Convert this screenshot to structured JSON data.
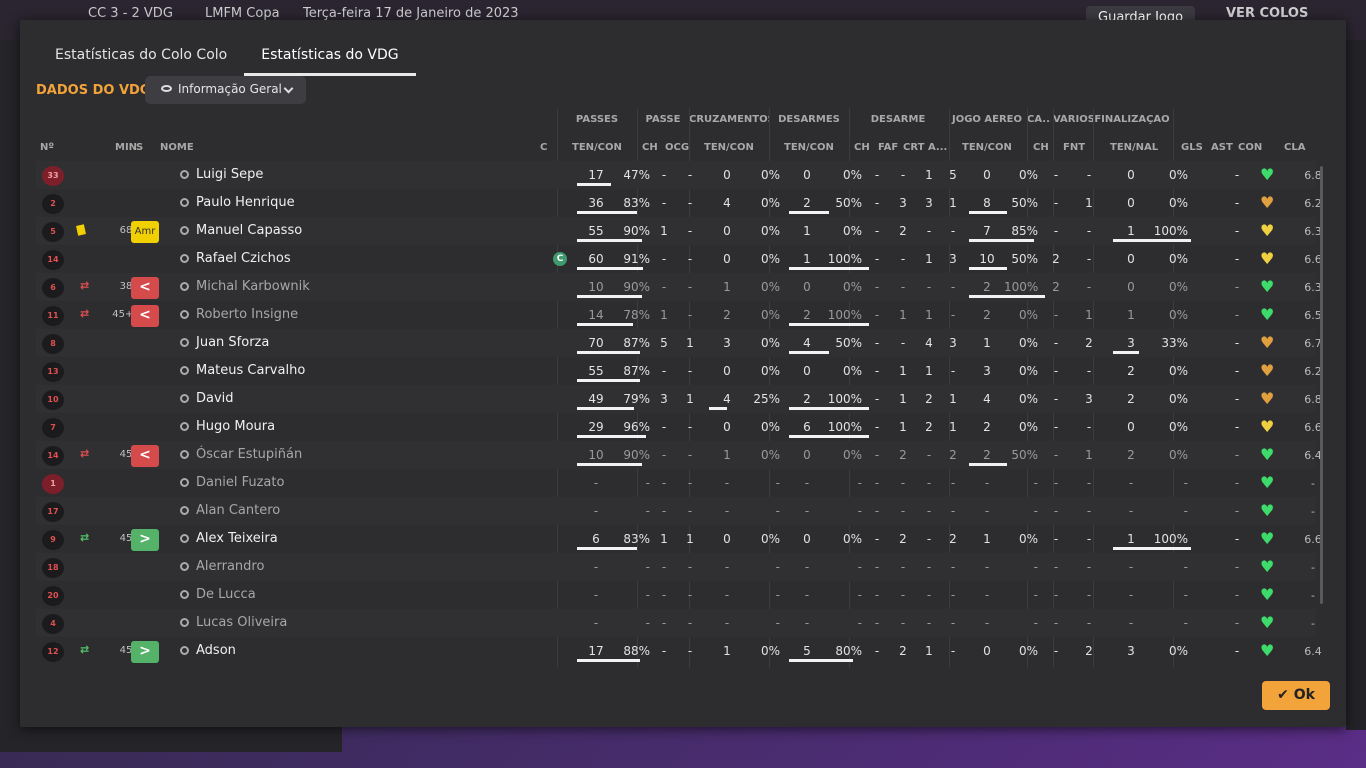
{
  "background": {
    "score": "CC 3 - 2 VDG",
    "league": "LMFM Copa",
    "date": "Terça-feira 17 de Janeiro de 2023",
    "save_label": "Guardar Jogo",
    "ver_label": "VER COLOS"
  },
  "tabs": [
    "Estatísticas do Colo Colo",
    "Estatísticas do VDG"
  ],
  "section_title": "DADOS DO VDG",
  "dropdown_label": "Informação Geral",
  "group_headers": [
    "PASSES",
    "PASSE",
    "CRUZAMENTOS",
    "DESARMES",
    "DESARME",
    "JOGO AÉREO",
    "CA...",
    "VÁRIOS",
    "FINALIZAÇÃO"
  ],
  "column_headers": {
    "no": "Nº",
    "min": "MIN",
    "s": "S",
    "nome": "NOME",
    "c": "C",
    "passes": "TEN/CON",
    "ch": "CH",
    "ocg": "OCG",
    "cruz": "TEN/CON",
    "des": "TEN/CON",
    "dch": "CH",
    "faf": "FAF",
    "crt": "CRT",
    "a": "A...",
    "aereo": "TEN/CON",
    "ca_ch": "CH",
    "fnt": "FNT",
    "fin": "TEN/NAL",
    "gls": "GLS",
    "ast": "AST",
    "con": "CON",
    "cla": "CLA"
  },
  "players": [
    {
      "no": "33",
      "gk": true,
      "name": "Luigi Sepe",
      "dim": false,
      "card": false,
      "sub": "",
      "min": "",
      "s": "",
      "cap": false,
      "p": [
        "17",
        "47%"
      ],
      "pc": [
        "-",
        "-"
      ],
      "cr": [
        "0",
        "0%"
      ],
      "de": [
        "0",
        "0%"
      ],
      "ds": [
        "-",
        "-",
        "1",
        "5"
      ],
      "ae": [
        "0",
        "0%"
      ],
      "ca": "-",
      "fnt": "-",
      "fi": [
        "0",
        "0%"
      ],
      "ast": "-",
      "heart": "#3ddc6a",
      "cla": "6.8"
    },
    {
      "no": "2",
      "gk": false,
      "name": "Paulo Henrique",
      "dim": false,
      "card": false,
      "sub": "",
      "min": "",
      "s": "",
      "cap": false,
      "p": [
        "36",
        "83%"
      ],
      "pc": [
        "-",
        "-"
      ],
      "cr": [
        "4",
        "0%"
      ],
      "de": [
        "2",
        "50%"
      ],
      "ds": [
        "-",
        "3",
        "3",
        "1"
      ],
      "ae": [
        "8",
        "50%"
      ],
      "ca": "-",
      "fnt": "1",
      "fi": [
        "0",
        "0%"
      ],
      "ast": "-",
      "heart": "#e0a040",
      "cla": "6.2"
    },
    {
      "no": "5",
      "gk": false,
      "name": "Manuel Capasso",
      "dim": false,
      "card": true,
      "sub": "amr",
      "min": "68",
      "s": "Amr",
      "cap": false,
      "p": [
        "55",
        "90%"
      ],
      "pc": [
        "1",
        "-"
      ],
      "cr": [
        "0",
        "0%"
      ],
      "de": [
        "1",
        "0%"
      ],
      "ds": [
        "-",
        "2",
        "-",
        "-"
      ],
      "ae": [
        "7",
        "85%"
      ],
      "ca": "-",
      "fnt": "-",
      "fi": [
        "1",
        "100%"
      ],
      "ast": "-",
      "heart": "#f0d040",
      "cla": "6.3"
    },
    {
      "no": "14",
      "gk": false,
      "name": "Rafael Czichos",
      "dim": false,
      "card": false,
      "sub": "",
      "min": "",
      "s": "",
      "cap": true,
      "p": [
        "60",
        "91%"
      ],
      "pc": [
        "-",
        "-"
      ],
      "cr": [
        "0",
        "0%"
      ],
      "de": [
        "1",
        "100%"
      ],
      "ds": [
        "-",
        "-",
        "1",
        "3"
      ],
      "ae": [
        "10",
        "50%"
      ],
      "ca": "2",
      "fnt": "-",
      "fi": [
        "0",
        "0%"
      ],
      "ast": "-",
      "heart": "#f0d040",
      "cla": "6.6"
    },
    {
      "no": "6",
      "gk": false,
      "name": "Michal Karbownik",
      "dim": true,
      "card": false,
      "sub": "out",
      "min": "38",
      "s": "<",
      "cap": false,
      "p": [
        "10",
        "90%"
      ],
      "pc": [
        "-",
        "-"
      ],
      "cr": [
        "1",
        "0%"
      ],
      "de": [
        "0",
        "0%"
      ],
      "ds": [
        "-",
        "-",
        "-",
        "-"
      ],
      "ae": [
        "2",
        "100%"
      ],
      "ca": "2",
      "fnt": "-",
      "fi": [
        "0",
        "0%"
      ],
      "ast": "-",
      "heart": "#3ddc6a",
      "cla": "6.3"
    },
    {
      "no": "11",
      "gk": false,
      "name": "Roberto Insigne",
      "dim": true,
      "card": false,
      "sub": "out",
      "min": "45+3",
      "s": "<",
      "cap": false,
      "p": [
        "14",
        "78%"
      ],
      "pc": [
        "1",
        "-"
      ],
      "cr": [
        "2",
        "0%"
      ],
      "de": [
        "2",
        "100%"
      ],
      "ds": [
        "-",
        "1",
        "1",
        "-"
      ],
      "ae": [
        "2",
        "0%"
      ],
      "ca": "-",
      "fnt": "1",
      "fi": [
        "1",
        "0%"
      ],
      "ast": "-",
      "heart": "#3ddc6a",
      "cla": "6.5"
    },
    {
      "no": "8",
      "gk": false,
      "name": "Juan Sforza",
      "dim": false,
      "card": false,
      "sub": "",
      "min": "",
      "s": "",
      "cap": false,
      "p": [
        "70",
        "87%"
      ],
      "pc": [
        "5",
        "1"
      ],
      "cr": [
        "3",
        "0%"
      ],
      "de": [
        "4",
        "50%"
      ],
      "ds": [
        "-",
        "-",
        "4",
        "3"
      ],
      "ae": [
        "1",
        "0%"
      ],
      "ca": "-",
      "fnt": "2",
      "fi": [
        "3",
        "33%"
      ],
      "ast": "-",
      "heart": "#e0a040",
      "cla": "6.7"
    },
    {
      "no": "13",
      "gk": false,
      "name": "Mateus Carvalho",
      "dim": false,
      "card": false,
      "sub": "",
      "min": "",
      "s": "",
      "cap": false,
      "p": [
        "55",
        "87%"
      ],
      "pc": [
        "-",
        "-"
      ],
      "cr": [
        "0",
        "0%"
      ],
      "de": [
        "0",
        "0%"
      ],
      "ds": [
        "-",
        "1",
        "1",
        "-"
      ],
      "ae": [
        "3",
        "0%"
      ],
      "ca": "-",
      "fnt": "-",
      "fi": [
        "2",
        "0%"
      ],
      "ast": "-",
      "heart": "#e0a040",
      "cla": "6.2"
    },
    {
      "no": "10",
      "gk": false,
      "name": "David",
      "dim": false,
      "card": false,
      "sub": "",
      "min": "",
      "s": "",
      "cap": false,
      "p": [
        "49",
        "79%"
      ],
      "pc": [
        "3",
        "1"
      ],
      "cr": [
        "4",
        "25%"
      ],
      "de": [
        "2",
        "100%"
      ],
      "ds": [
        "-",
        "1",
        "2",
        "1"
      ],
      "ae": [
        "4",
        "0%"
      ],
      "ca": "-",
      "fnt": "3",
      "fi": [
        "2",
        "0%"
      ],
      "ast": "-",
      "heart": "#e0a040",
      "cla": "6.8"
    },
    {
      "no": "7",
      "gk": false,
      "name": "Hugo Moura",
      "dim": false,
      "card": false,
      "sub": "",
      "min": "",
      "s": "",
      "cap": false,
      "p": [
        "29",
        "96%"
      ],
      "pc": [
        "-",
        "-"
      ],
      "cr": [
        "0",
        "0%"
      ],
      "de": [
        "6",
        "100%"
      ],
      "ds": [
        "-",
        "1",
        "2",
        "1"
      ],
      "ae": [
        "2",
        "0%"
      ],
      "ca": "-",
      "fnt": "-",
      "fi": [
        "0",
        "0%"
      ],
      "ast": "-",
      "heart": "#f0d040",
      "cla": "6.6"
    },
    {
      "no": "14",
      "gk": false,
      "name": "Óscar Estupiñán",
      "dim": true,
      "card": false,
      "sub": "out",
      "min": "45",
      "s": "<",
      "cap": false,
      "p": [
        "10",
        "90%"
      ],
      "pc": [
        "-",
        "-"
      ],
      "cr": [
        "1",
        "0%"
      ],
      "de": [
        "0",
        "0%"
      ],
      "ds": [
        "-",
        "2",
        "-",
        "2"
      ],
      "ae": [
        "2",
        "50%"
      ],
      "ca": "-",
      "fnt": "1",
      "fi": [
        "2",
        "0%"
      ],
      "ast": "-",
      "heart": "#3ddc6a",
      "cla": "6.4"
    },
    {
      "no": "1",
      "gk": true,
      "name": "Daniel Fuzato",
      "dim": true,
      "card": false,
      "sub": "",
      "min": "",
      "s": "",
      "cap": false,
      "p": [
        "-",
        "-"
      ],
      "pc": [
        "-",
        "-"
      ],
      "cr": [
        "-",
        "-"
      ],
      "de": [
        "-",
        "-"
      ],
      "ds": [
        "-",
        "-",
        "-",
        "-"
      ],
      "ae": [
        "-",
        "-"
      ],
      "ca": "-",
      "fnt": "-",
      "fi": [
        "-",
        "-"
      ],
      "ast": "-",
      "heart": "#3ddc6a",
      "cla": "-"
    },
    {
      "no": "17",
      "gk": false,
      "name": "Alan Cantero",
      "dim": true,
      "card": false,
      "sub": "",
      "min": "",
      "s": "",
      "cap": false,
      "p": [
        "-",
        "-"
      ],
      "pc": [
        "-",
        "-"
      ],
      "cr": [
        "-",
        "-"
      ],
      "de": [
        "-",
        "-"
      ],
      "ds": [
        "-",
        "-",
        "-",
        "-"
      ],
      "ae": [
        "-",
        "-"
      ],
      "ca": "-",
      "fnt": "-",
      "fi": [
        "-",
        "-"
      ],
      "ast": "-",
      "heart": "#3ddc6a",
      "cla": "-"
    },
    {
      "no": "9",
      "gk": false,
      "name": "Alex Teixeira",
      "dim": false,
      "card": false,
      "sub": "in",
      "min": "45",
      "s": ">",
      "cap": false,
      "p": [
        "6",
        "83%"
      ],
      "pc": [
        "1",
        "1"
      ],
      "cr": [
        "0",
        "0%"
      ],
      "de": [
        "0",
        "0%"
      ],
      "ds": [
        "-",
        "2",
        "-",
        "2"
      ],
      "ae": [
        "1",
        "0%"
      ],
      "ca": "-",
      "fnt": "-",
      "fi": [
        "1",
        "100%"
      ],
      "ast": "-",
      "heart": "#3ddc6a",
      "cla": "6.6"
    },
    {
      "no": "18",
      "gk": false,
      "name": "Alerrandro",
      "dim": true,
      "card": false,
      "sub": "",
      "min": "",
      "s": "",
      "cap": false,
      "p": [
        "-",
        "-"
      ],
      "pc": [
        "-",
        "-"
      ],
      "cr": [
        "-",
        "-"
      ],
      "de": [
        "-",
        "-"
      ],
      "ds": [
        "-",
        "-",
        "-",
        "-"
      ],
      "ae": [
        "-",
        "-"
      ],
      "ca": "-",
      "fnt": "-",
      "fi": [
        "-",
        "-"
      ],
      "ast": "-",
      "heart": "#3ddc6a",
      "cla": "-"
    },
    {
      "no": "20",
      "gk": false,
      "name": "De Lucca",
      "dim": true,
      "card": false,
      "sub": "",
      "min": "",
      "s": "",
      "cap": false,
      "p": [
        "-",
        "-"
      ],
      "pc": [
        "-",
        "-"
      ],
      "cr": [
        "-",
        "-"
      ],
      "de": [
        "-",
        "-"
      ],
      "ds": [
        "-",
        "-",
        "-",
        "-"
      ],
      "ae": [
        "-",
        "-"
      ],
      "ca": "-",
      "fnt": "-",
      "fi": [
        "-",
        "-"
      ],
      "ast": "-",
      "heart": "#3ddc6a",
      "cla": "-"
    },
    {
      "no": "4",
      "gk": false,
      "name": "Lucas Oliveira",
      "dim": true,
      "card": false,
      "sub": "",
      "min": "",
      "s": "",
      "cap": false,
      "p": [
        "-",
        "-"
      ],
      "pc": [
        "-",
        "-"
      ],
      "cr": [
        "-",
        "-"
      ],
      "de": [
        "-",
        "-"
      ],
      "ds": [
        "-",
        "-",
        "-",
        "-"
      ],
      "ae": [
        "-",
        "-"
      ],
      "ca": "-",
      "fnt": "-",
      "fi": [
        "-",
        "-"
      ],
      "ast": "-",
      "heart": "#3ddc6a",
      "cla": "-"
    },
    {
      "no": "12",
      "gk": false,
      "name": "Adson",
      "dim": false,
      "card": false,
      "sub": "in",
      "min": "45",
      "s": ">",
      "cap": false,
      "p": [
        "17",
        "88%"
      ],
      "pc": [
        "-",
        "-"
      ],
      "cr": [
        "1",
        "0%"
      ],
      "de": [
        "5",
        "80%"
      ],
      "ds": [
        "-",
        "2",
        "1",
        "-"
      ],
      "ae": [
        "0",
        "0%"
      ],
      "ca": "-",
      "fnt": "2",
      "fi": [
        "3",
        "0%"
      ],
      "ast": "-",
      "heart": "#3ddc6a",
      "cla": "6.4"
    }
  ],
  "ok_label": "Ok"
}
